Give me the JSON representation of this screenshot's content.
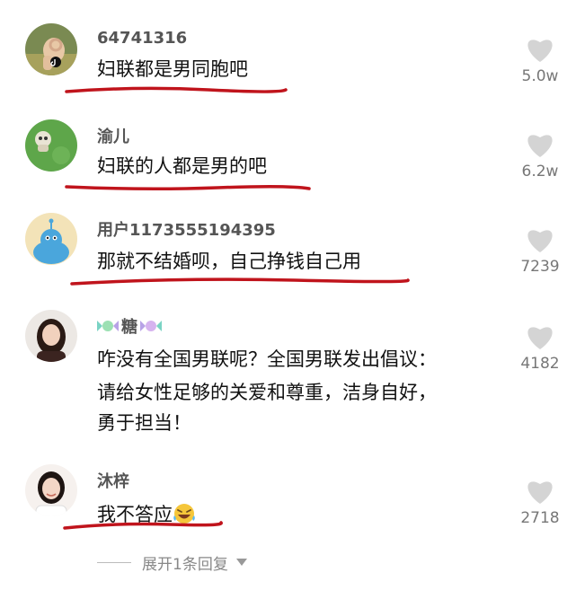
{
  "comments": [
    {
      "username": "64741316",
      "text": "妇联都是男同胞吧",
      "likes": "5.0w",
      "avatar": "hand-ok-gesture-avatar"
    },
    {
      "username": "渝儿",
      "text": "妇联的人都是男的吧",
      "likes": "6.2w",
      "avatar": "green-grass-avatar"
    },
    {
      "username": "用户1173555194395",
      "text": "那就不结婚呗，自己挣钱自己用",
      "likes": "7239",
      "avatar": "cartoon-blue-creature-avatar"
    },
    {
      "username": "糖",
      "text_lines": [
        "咋没有全国男联呢？全国男联发出倡议：",
        "请给女性足够的关爱和尊重，洁身自好，",
        "勇于担当！"
      ],
      "likes": "4182",
      "avatar": "woman-portrait-avatar"
    },
    {
      "username": "沐梓",
      "text": "我不答应",
      "likes": "2718",
      "avatar": "smiling-woman-avatar"
    }
  ],
  "expand_replies": "展开1条回复",
  "colors": {
    "underline": "#c0141c",
    "heart": "#d4d4d4",
    "count": "#777777"
  }
}
